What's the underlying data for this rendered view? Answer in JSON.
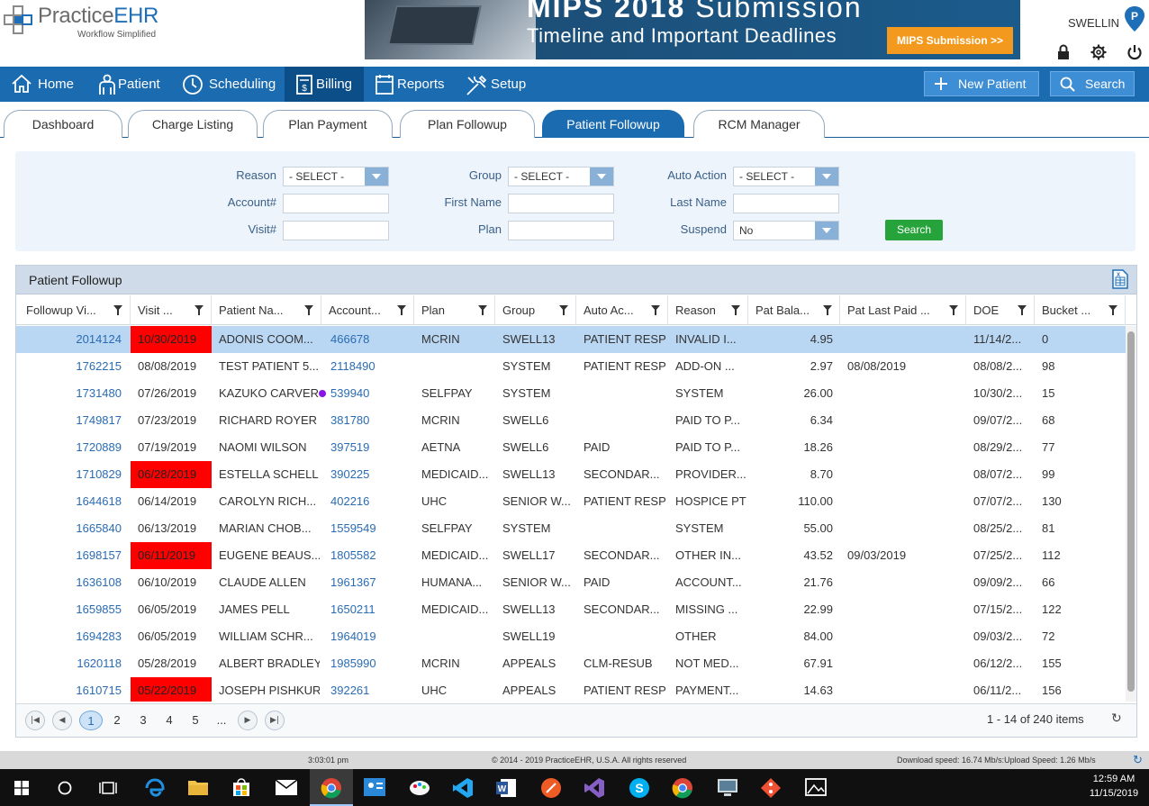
{
  "logo": {
    "brand_a": "Practice",
    "brand_b": "EHR",
    "tagline": "Workflow Simplified"
  },
  "banner": {
    "line1_bold": "MIPS 2018",
    "line1_rest": " Submission",
    "line2": "Timeline and Important Deadlines",
    "cta": "MIPS Submission >>"
  },
  "user": {
    "name": "SWELLIN"
  },
  "nav": {
    "items": [
      {
        "label": "Home",
        "icon": "home-icon"
      },
      {
        "label": "Patient",
        "icon": "patient-icon"
      },
      {
        "label": "Scheduling",
        "icon": "clock-icon"
      },
      {
        "label": "Billing",
        "icon": "billing-icon"
      },
      {
        "label": "Reports",
        "icon": "reports-icon"
      },
      {
        "label": "Setup",
        "icon": "tools-icon"
      }
    ],
    "active": "Billing",
    "new_patient": "New Patient",
    "search": "Search"
  },
  "tabs": [
    "Dashboard",
    "Charge Listing",
    "Plan Payment",
    "Plan Followup",
    "Patient Followup",
    "RCM Manager"
  ],
  "active_tab": "Patient Followup",
  "filters": {
    "reason_label": "Reason",
    "reason_value": "- SELECT -",
    "group_label": "Group",
    "group_value": "- SELECT -",
    "auto_action_label": "Auto Action",
    "auto_action_value": "- SELECT -",
    "account_label": "Account#",
    "account_value": "",
    "first_name_label": "First Name",
    "first_name_value": "",
    "last_name_label": "Last Name",
    "last_name_value": "",
    "visit_label": "Visit#",
    "visit_value": "",
    "plan_label": "Plan",
    "plan_value": "",
    "suspend_label": "Suspend",
    "suspend_value": "No",
    "search_button": "Search"
  },
  "grid": {
    "title": "Patient Followup",
    "columns": [
      "Followup Vi...",
      "Visit ...",
      "Patient Na...",
      "Account...",
      "Plan",
      "Group",
      "Auto Ac...",
      "Reason",
      "Pat Bala...",
      "Pat Last Paid ...",
      "DOE",
      "Bucket ..."
    ],
    "rows": [
      {
        "followup": "2014124",
        "visit": "10/30/2019",
        "visit_red": true,
        "patient": "ADONIS COOM...",
        "account": "466678",
        "plan": "MCRIN",
        "group": "SWELL13",
        "auto": "PATIENT RESP",
        "reason": "INVALID I...",
        "bal": "4.95",
        "last_paid": "",
        "doe": "11/14/2...",
        "bucket": "0",
        "selected": true
      },
      {
        "followup": "1762215",
        "visit": "08/08/2019",
        "patient": "TEST PATIENT 5...",
        "account": "2118490",
        "plan": "",
        "group": "SYSTEM",
        "auto": "PATIENT RESP",
        "reason": "ADD-ON ...",
        "bal": "2.97",
        "last_paid": "08/08/2019",
        "doe": "08/08/2...",
        "bucket": "98"
      },
      {
        "followup": "1731480",
        "visit": "07/26/2019",
        "patient": "KAZUKO CARVER",
        "account": "539940",
        "dot": true,
        "plan": "SELFPAY",
        "group": "SYSTEM",
        "auto": "",
        "reason": "SYSTEM",
        "bal": "26.00",
        "last_paid": "",
        "doe": "10/30/2...",
        "bucket": "15"
      },
      {
        "followup": "1749817",
        "visit": "07/23/2019",
        "patient": "RICHARD ROYER",
        "account": "381780",
        "plan": "MCRIN",
        "group": "SWELL6",
        "auto": "",
        "reason": "PAID TO P...",
        "bal": "6.34",
        "last_paid": "",
        "doe": "09/07/2...",
        "bucket": "68"
      },
      {
        "followup": "1720889",
        "visit": "07/19/2019",
        "patient": "NAOMI WILSON",
        "account": "397519",
        "plan": "AETNA",
        "group": "SWELL6",
        "auto": "PAID",
        "reason": "PAID TO P...",
        "bal": "18.26",
        "last_paid": "",
        "doe": "08/29/2...",
        "bucket": "77"
      },
      {
        "followup": "1710829",
        "visit": "06/28/2019",
        "visit_red": true,
        "patient": "ESTELLA SCHELL",
        "account": "390225",
        "plan": "MEDICAID...",
        "group": "SWELL13",
        "auto": "SECONDAR...",
        "reason": "PROVIDER...",
        "bal": "8.70",
        "last_paid": "",
        "doe": "08/07/2...",
        "bucket": "99"
      },
      {
        "followup": "1644618",
        "visit": "06/14/2019",
        "patient": "CAROLYN RICH...",
        "account": "402216",
        "plan": "UHC",
        "group": "SENIOR W...",
        "auto": "PATIENT RESP",
        "reason": "HOSPICE PT",
        "bal": "110.00",
        "last_paid": "",
        "doe": "07/07/2...",
        "bucket": "130"
      },
      {
        "followup": "1665840",
        "visit": "06/13/2019",
        "patient": "MARIAN CHOB...",
        "account": "1559549",
        "plan": "SELFPAY",
        "group": "SYSTEM",
        "auto": "",
        "reason": "SYSTEM",
        "bal": "55.00",
        "last_paid": "",
        "doe": "08/25/2...",
        "bucket": "81"
      },
      {
        "followup": "1698157",
        "visit": "06/11/2019",
        "visit_red": true,
        "patient": "EUGENE BEAUS...",
        "account": "1805582",
        "plan": "MEDICAID...",
        "group": "SWELL17",
        "auto": "SECONDAR...",
        "reason": "OTHER IN...",
        "bal": "43.52",
        "last_paid": "09/03/2019",
        "doe": "07/25/2...",
        "bucket": "112"
      },
      {
        "followup": "1636108",
        "visit": "06/10/2019",
        "patient": "CLAUDE ALLEN",
        "account": "1961367",
        "plan": "HUMANA...",
        "group": "SENIOR W...",
        "auto": "PAID",
        "reason": "ACCOUNT...",
        "bal": "21.76",
        "last_paid": "",
        "doe": "09/09/2...",
        "bucket": "66"
      },
      {
        "followup": "1659855",
        "visit": "06/05/2019",
        "patient": "JAMES PELL",
        "account": "1650211",
        "plan": "MEDICAID...",
        "group": "SWELL13",
        "auto": "SECONDAR...",
        "reason": "MISSING ...",
        "bal": "22.99",
        "last_paid": "",
        "doe": "07/15/2...",
        "bucket": "122"
      },
      {
        "followup": "1694283",
        "visit": "06/05/2019",
        "patient": "WILLIAM SCHR...",
        "account": "1964019",
        "plan": "",
        "group": "SWELL19",
        "auto": "",
        "reason": "OTHER",
        "bal": "84.00",
        "last_paid": "",
        "doe": "09/03/2...",
        "bucket": "72"
      },
      {
        "followup": "1620118",
        "visit": "05/28/2019",
        "patient": "ALBERT BRADLEY",
        "account": "1985990",
        "plan": "MCRIN",
        "group": "APPEALS",
        "auto": "CLM-RESUB",
        "reason": "NOT MED...",
        "bal": "67.91",
        "last_paid": "",
        "doe": "06/12/2...",
        "bucket": "155"
      },
      {
        "followup": "1610715",
        "visit": "05/22/2019",
        "visit_red": true,
        "patient": "JOSEPH PISHKUR",
        "account": "392261",
        "plan": "UHC",
        "group": "APPEALS",
        "auto": "PATIENT RESP",
        "reason": "PAYMENT...",
        "bal": "14.63",
        "last_paid": "",
        "doe": "06/11/2...",
        "bucket": "156"
      }
    ],
    "pages": [
      "1",
      "2",
      "3",
      "4",
      "5",
      "..."
    ],
    "current_page": "1",
    "info": "1 - 14 of 240 items"
  },
  "footer": {
    "time": "3:03:01 pm",
    "copyright": "© 2014 - 2019 PracticeEHR, U.S.A. All rights reserved",
    "speed": "Download speed: 16.74 Mb/s:Upload Speed: 1.26 Mb/s"
  },
  "taskbar": {
    "time": "12:59 AM",
    "date": "11/15/2019"
  },
  "colors": {
    "nav": "#1a6bb0",
    "nav_active": "#0c4f88",
    "red_cell": "#ff0000",
    "selected_row": "#b9d6f3",
    "search_green": "#27a33b"
  }
}
